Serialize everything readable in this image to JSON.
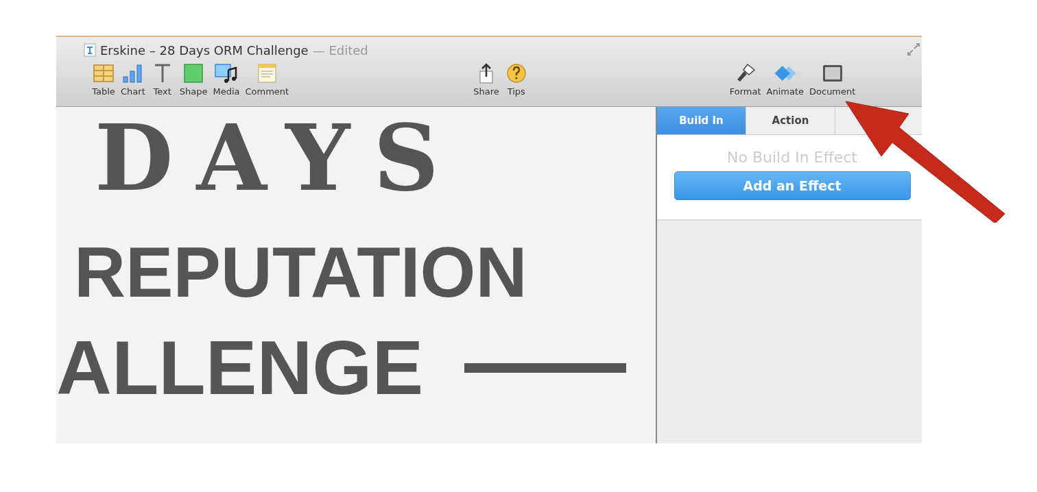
{
  "window": {
    "title": "Erskine – 28 Days ORM Challenge",
    "status": "— Edited"
  },
  "toolbar": {
    "left": [
      {
        "kind": "table",
        "label": "Table"
      },
      {
        "kind": "chart",
        "label": "Chart"
      },
      {
        "kind": "text",
        "label": "Text"
      },
      {
        "kind": "shape",
        "label": "Shape"
      },
      {
        "kind": "media",
        "label": "Media"
      },
      {
        "kind": "comment",
        "label": "Comment"
      }
    ],
    "middle": [
      {
        "kind": "share",
        "label": "Share"
      },
      {
        "kind": "tips",
        "label": "Tips"
      }
    ],
    "right": [
      {
        "kind": "format",
        "label": "Format"
      },
      {
        "kind": "animate",
        "label": "Animate"
      },
      {
        "kind": "document",
        "label": "Document"
      }
    ]
  },
  "slide": {
    "lines": [
      "DAYS",
      "REPUTATION",
      "ALLENGE"
    ]
  },
  "inspector": {
    "tabs": [
      {
        "label": "Build In",
        "selected": true
      },
      {
        "label": "Action",
        "selected": false
      }
    ],
    "empty_message": "No Build In Effect",
    "button": "Add an Effect"
  }
}
